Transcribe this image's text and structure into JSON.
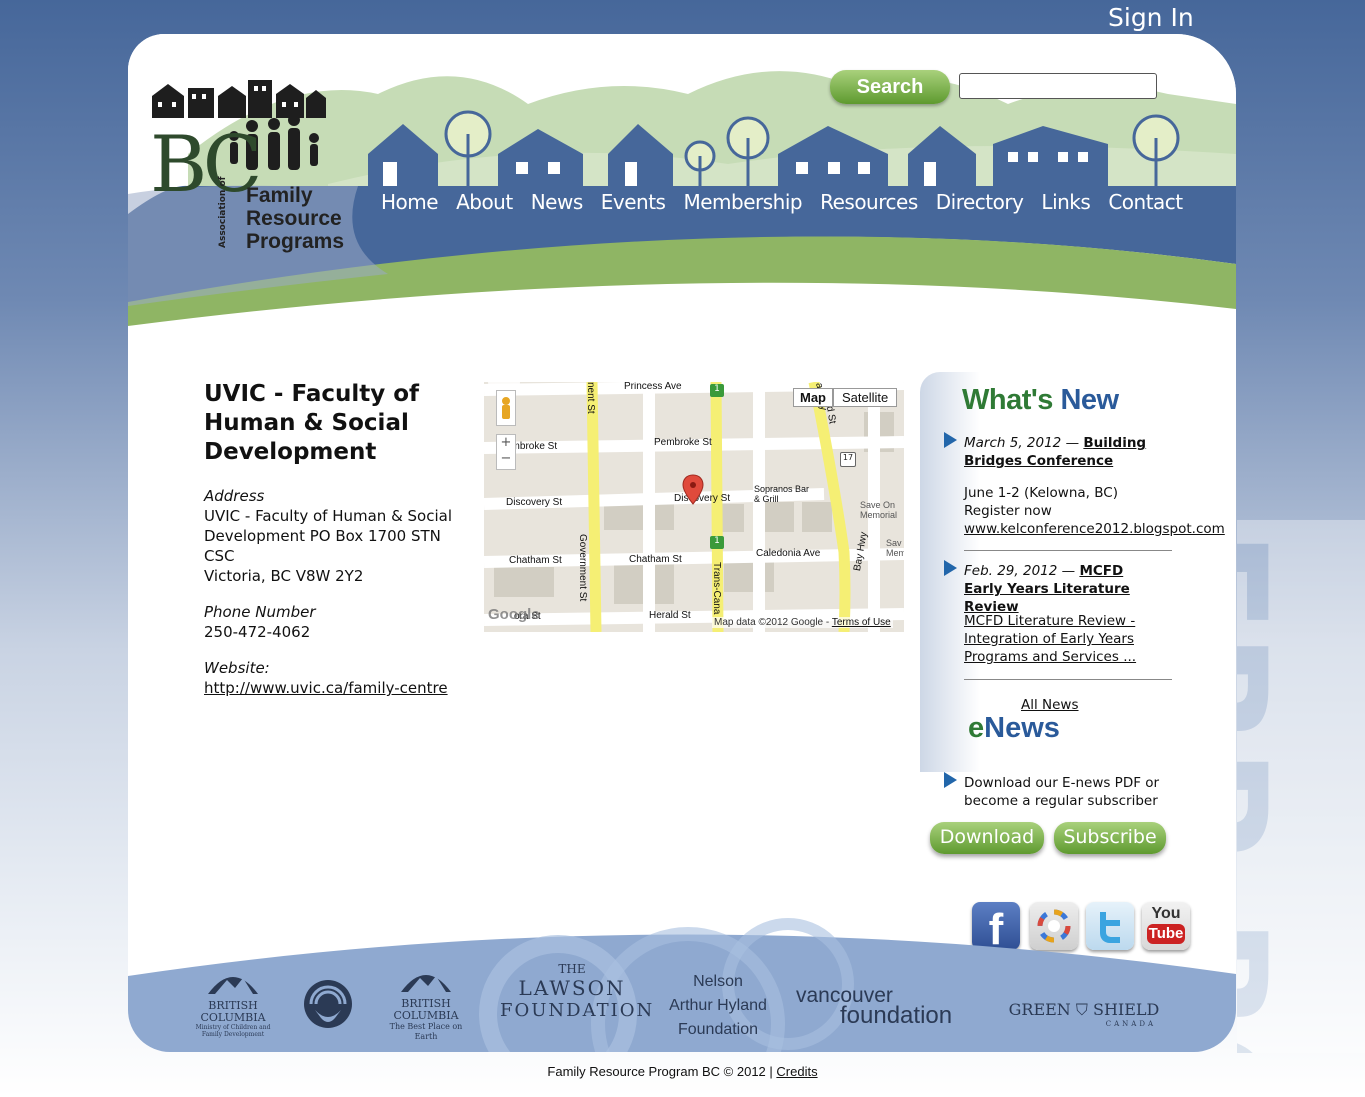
{
  "header": {
    "sign_in": "Sign In",
    "search_label": "Search",
    "search_value": "",
    "logo": {
      "bc": "BC",
      "association": "Association of",
      "name_lines": [
        "Family",
        "Resource",
        "Programs"
      ]
    },
    "nav": [
      "Home",
      "About",
      "News",
      "Events",
      "Membership",
      "Resources",
      "Directory",
      "Links",
      "Contact"
    ]
  },
  "org": {
    "title": "UVIC - Faculty of Human & Social Development",
    "address_label": "Address",
    "address_lines": [
      "UVIC - Faculty of Human & Social",
      "Development PO Box 1700 STN CSC",
      "Victoria, BC V8W 2Y2"
    ],
    "phone_label": "Phone Number",
    "phone": "250-472-4062",
    "website_label": "Website:",
    "website": "http://www.uvic.ca/family-centre"
  },
  "map": {
    "type_map": "Map",
    "type_satellite": "Satellite",
    "zoom_in": "+",
    "zoom_out": "−",
    "streets": {
      "princess": "Princess Ave",
      "pembroke_left": "embroke St",
      "pembroke": "Pembroke St",
      "discovery_left": "Discovery St",
      "discovery": "Discovery St",
      "chatham_left": "Chatham St",
      "chatham": "Chatham St",
      "caledonia": "Caledonia Ave",
      "herald_left": "ora St",
      "herald": "Herald St",
      "government": "Government St",
      "government_top": "nent St",
      "trans_canada": "Trans-Cana",
      "bay_hwy": "Bay Hwy",
      "hwy_top": "a Hwy",
      "rd_st": "rd St"
    },
    "poi_sopranos": "Sopranos Bar & Grill",
    "poi_save_on": "Save On Memorial",
    "poi_sav": "Sav Mem",
    "shields": [
      "1",
      "1",
      "17"
    ],
    "attribution": "Map data ©2012 Google",
    "terms": "Terms of Use",
    "google": "Google"
  },
  "sidebar": {
    "whats_new_a": "What's",
    "whats_new_b": " New",
    "news": [
      {
        "date": "March 5, 2012",
        "dash": " — ",
        "title": "Building Bridges Conference",
        "body_lines": [
          "June 1-2 (Kelowna, BC)",
          "Register now"
        ],
        "link": "www.kelconference2012.blogspot.com"
      },
      {
        "date": "Feb. 29, 2012",
        "dash": " — ",
        "title": "MCFD Early Years Literature Review",
        "link": "MCFD Literature Review - Integration of Early Years Programs and Services ..."
      }
    ],
    "all_news": "All News",
    "enews_e": "e",
    "enews_rest": "News",
    "enews_text": "Download our E-news PDF or become a regular subscriber",
    "download": "Download",
    "subscribe": "Subscribe"
  },
  "social": {
    "facebook": "f",
    "youtube_top": "You",
    "youtube_bottom": "Tube"
  },
  "sponsors": {
    "bc_mcfd_name": "BRITISH COLUMBIA",
    "bc_mcfd_sub": "Ministry of Children and Family Development",
    "bc_best_name": "BRITISH COLUMBIA",
    "bc_best_sub": "The Best Place on Earth",
    "lawson_the": "THE",
    "lawson_name": "LAWSON",
    "lawson_foundation": "FOUNDATION",
    "nelson_lines": [
      "Nelson",
      "Arthur Hyland",
      "Foundation"
    ],
    "vancouver_a": "vancouver",
    "vancouver_b": "foundation",
    "green_shield_a": "GREEN",
    "green_shield_b": "SHIELD",
    "green_shield_c": "CANADA"
  },
  "footer": {
    "copyright": "Family Resource Program BC © 2012 | ",
    "credits": "Credits"
  },
  "watermark": "FRP-BC",
  "colors": {
    "navy": "#46679a",
    "green": "#5e9a2f",
    "accent_blue": "#2266aa"
  }
}
